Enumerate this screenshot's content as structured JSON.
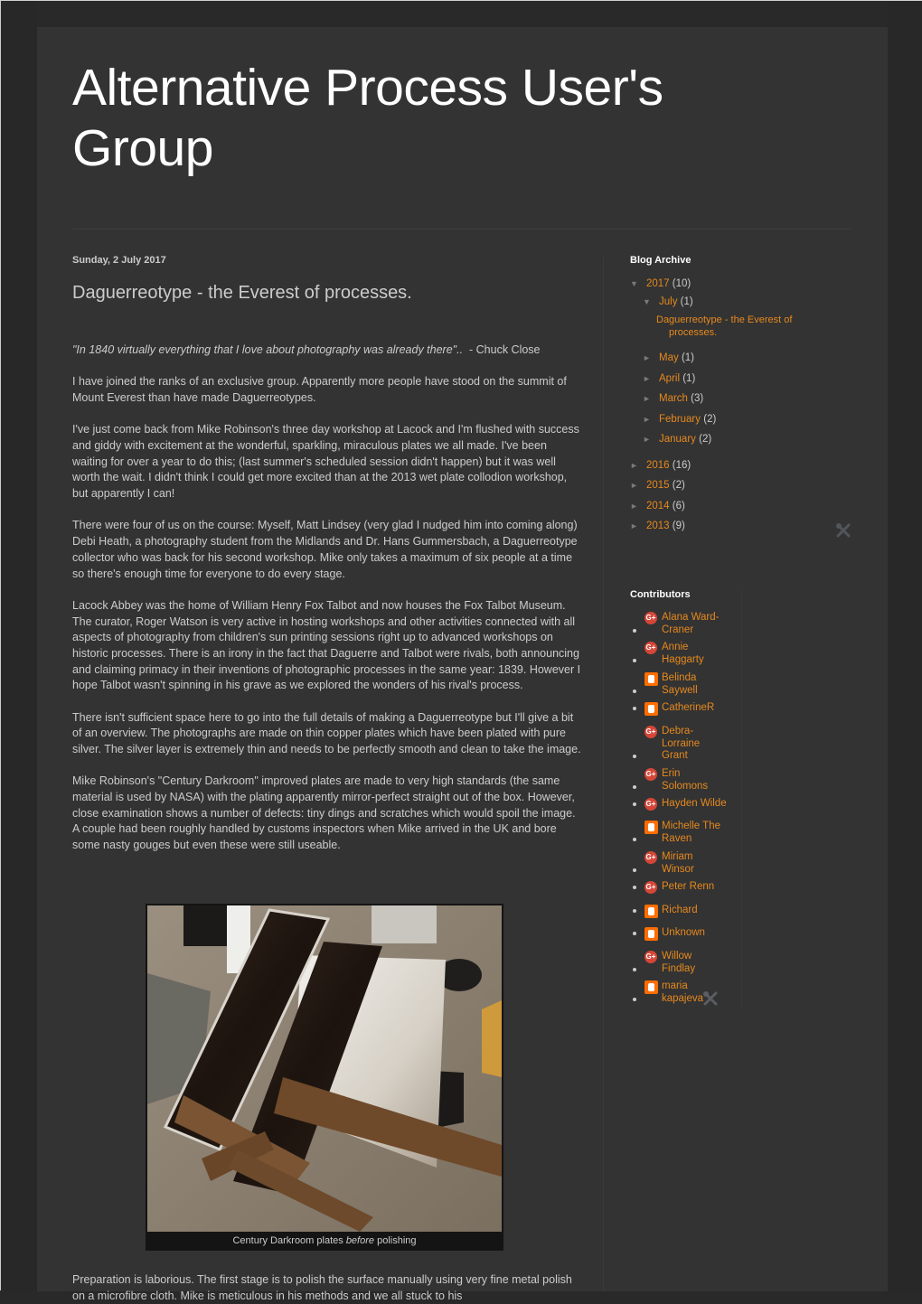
{
  "header": {
    "title": "Alternative Process User's Group"
  },
  "post": {
    "date": "Sunday, 2 July 2017",
    "title": "Daguerreotype - the Everest of processes.",
    "quote_italic": "\"In 1840 virtually everything that I love about photography was already there\"..",
    "quote_attribution": "  - Chuck Close",
    "paragraphs": [
      "I have joined the ranks of an exclusive group. Apparently more people have stood on the summit of Mount Everest than have made Daguerreotypes.",
      "I've just come back from Mike Robinson's three day workshop at Lacock and I'm flushed with success and giddy with excitement at the wonderful, sparkling, miraculous plates we all made. I've been waiting for over a year to do this; (last summer's scheduled session didn't happen) but it was well worth the wait.  I didn't think I could get more excited than at the 2013 wet plate collodion workshop, but apparently I can!",
      "There were four of us on the course: Myself, Matt Lindsey (very glad I nudged him into coming along) Debi Heath, a photography student from the Midlands and Dr. Hans Gummersbach, a Daguerreotype collector who was back for his second workshop.  Mike only takes a maximum of six people at a time so there's enough time for everyone to do every stage.",
      "Lacock Abbey was the home of William Henry Fox Talbot and now houses the Fox Talbot Museum.  The curator, Roger Watson is very active in hosting workshops and other activities connected with all aspects of photography from children's sun printing sessions right up to advanced workshops on historic processes.  There is an irony in the fact that Daguerre and Talbot were rivals, both announcing and claiming primacy in their inventions of photographic processes in the same year: 1839.  However I hope Talbot wasn't spinning in his grave as we explored the wonders of his rival's process.",
      "There isn't sufficient space here to go into the full details of making a Daguerreotype but I'll give a bit of an overview.  The photographs are made on thin copper plates which have been plated with pure silver. The silver layer is extremely thin and needs to be perfectly smooth and clean to take the image.",
      "Mike Robinson's \"Century Darkroom\" improved plates are made to very high standards (the same material is used by NASA) with the plating apparently mirror-perfect straight out of the box.  However, close examination shows a number of defects: tiny dings and scratches which would spoil the image. A couple had been roughly handled by customs inspectors when Mike arrived in the UK and bore some nasty gouges but even these were still useable."
    ],
    "image": {
      "alt": "Century Darkroom daguerreotype plates on wooden stands",
      "caption_before": "Century Darkroom plates ",
      "caption_italic": "before",
      "caption_after": " polishing"
    },
    "paragraph_after_image": "Preparation is laborious. The first stage is to polish the surface manually using very fine metal polish on a microfibre cloth. Mike is meticulous in his methods and we all stuck to his"
  },
  "sidebar": {
    "archive": {
      "title": "Blog Archive",
      "expanded_icon": "▼",
      "collapsed_icon": "►",
      "years": [
        {
          "label": "2017",
          "count": "(10)",
          "expanded": true
        },
        {
          "label": "2016",
          "count": "(16)",
          "expanded": false
        },
        {
          "label": "2015",
          "count": "(2)",
          "expanded": false
        },
        {
          "label": "2014",
          "count": "(6)",
          "expanded": false
        },
        {
          "label": "2013",
          "count": "(9)",
          "expanded": false
        }
      ],
      "months_2017": [
        {
          "label": "July",
          "count": "(1)",
          "expanded": true
        },
        {
          "label": "May",
          "count": "(1)",
          "expanded": false
        },
        {
          "label": "April",
          "count": "(1)",
          "expanded": false
        },
        {
          "label": "March",
          "count": "(3)",
          "expanded": false
        },
        {
          "label": "February",
          "count": "(2)",
          "expanded": false
        },
        {
          "label": "January",
          "count": "(2)",
          "expanded": false
        }
      ],
      "july_posts": [
        {
          "title_line1": "Daguerreotype - the Everest of",
          "title_line2": "processes."
        }
      ]
    },
    "contributors": {
      "title": "Contributors",
      "items": [
        {
          "name_line1": "Alana Ward-",
          "name_line2": "Craner",
          "profile": "google-plus"
        },
        {
          "name_line1": "Annie",
          "name_line2": "Haggarty",
          "profile": "google-plus"
        },
        {
          "name_line1": "Belinda",
          "name_line2": "Saywell",
          "profile": "blogger"
        },
        {
          "name_line1": "CatherineR",
          "name_line2": "",
          "profile": "blogger"
        },
        {
          "name_line1": "Debra-",
          "name_line2": "Lorraine",
          "name_line3": "Grant",
          "profile": "google-plus"
        },
        {
          "name_line1": "Erin",
          "name_line2": "Solomons",
          "profile": "google-plus"
        },
        {
          "name_line1": "Hayden Wilde",
          "name_line2": "",
          "profile": "google-plus"
        },
        {
          "name_line1": "Michelle The",
          "name_line2": "Raven",
          "profile": "blogger"
        },
        {
          "name_line1": "Miriam",
          "name_line2": "Winsor",
          "profile": "google-plus"
        },
        {
          "name_line1": "Peter Renn",
          "name_line2": "",
          "profile": "google-plus"
        },
        {
          "name_line1": "Richard",
          "name_line2": "",
          "profile": "blogger"
        },
        {
          "name_line1": "Unknown",
          "name_line2": "",
          "profile": "blogger"
        },
        {
          "name_line1": "Willow",
          "name_line2": "Findlay",
          "profile": "google-plus"
        },
        {
          "name_line1": "maria",
          "name_line2": "kapajeva",
          "profile": "blogger"
        }
      ],
      "gplus_badge_text": "G+"
    }
  },
  "colors": {
    "link": "#e6891e",
    "background": "#333333",
    "outer_background": "#292929",
    "text": "#cccccc",
    "title": "#ffffff",
    "google_plus": "#d44638",
    "blogger": "#ff6d00"
  }
}
